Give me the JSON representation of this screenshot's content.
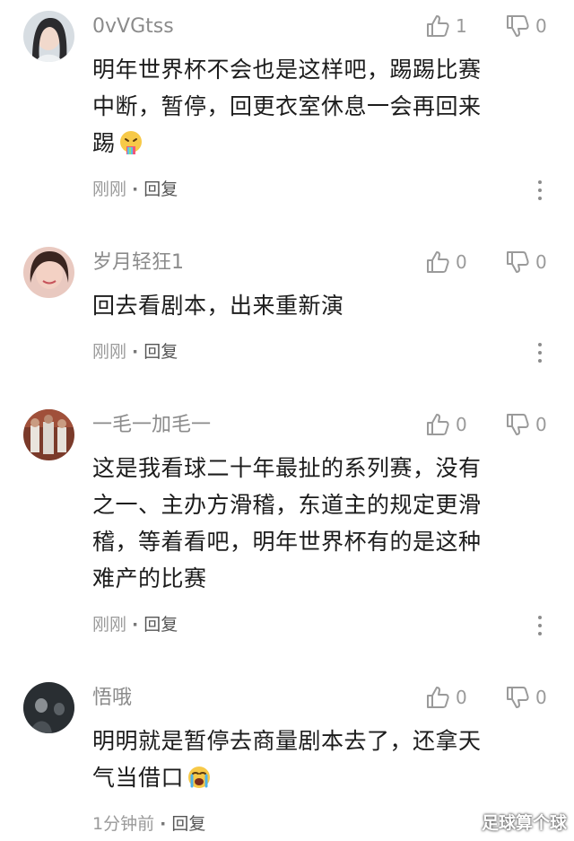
{
  "comments": [
    {
      "username": "0vVGtss",
      "lines": [
        "明年世界杯不会也是这样吧，踢踢比赛",
        "中断，暂停，回更衣室休息一会再回来",
        "踢"
      ],
      "like_count": "1",
      "dislike_count": "0",
      "time": "刚刚",
      "separator": "·",
      "reply_label": "回复",
      "emoji": "vomiting-face-emoji",
      "avatar_color": "#5b6a74"
    },
    {
      "username": "岁月轻狂1",
      "lines": [
        "回去看剧本，出来重新演"
      ],
      "like_count": "0",
      "dislike_count": "0",
      "time": "刚刚",
      "separator": "·",
      "reply_label": "回复",
      "avatar_color": "#c98f80"
    },
    {
      "username": "一毛一加毛一",
      "lines": [
        "这是我看球二十年最扯的系列赛，没有",
        "之一、主办方滑稽，东道主的规定更滑",
        "稽，等着看吧，明年世界杯有的是这种",
        "难产的比赛"
      ],
      "like_count": "0",
      "dislike_count": "0",
      "time": "刚刚",
      "separator": "·",
      "reply_label": "回复",
      "avatar_color": "#6b3b2e"
    },
    {
      "username": "悟哦",
      "lines": [
        "明明就是暂停去商量剧本去了，还拿天",
        "气当借口"
      ],
      "like_count": "0",
      "dislike_count": "0",
      "time": "1分钟前",
      "separator": "·",
      "reply_label": "回复",
      "emoji": "loudly-crying-face-emoji",
      "avatar_color": "#2a2f33"
    }
  ],
  "watermark": "足球算个球",
  "colors": {
    "username": "#8b8b8b",
    "text": "#1c1c1c",
    "meta": "#9a9a9a",
    "icon": "#9a9a9a"
  }
}
